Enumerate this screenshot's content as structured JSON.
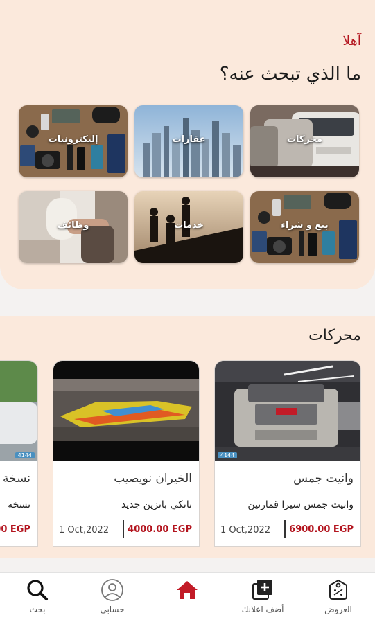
{
  "header": {
    "greeting": "آهلا",
    "question": "ما الذي تبحث عنه؟"
  },
  "categories": [
    {
      "label": "محركات",
      "icon": "cars-photo"
    },
    {
      "label": "عقارات",
      "icon": "skyscrapers-photo"
    },
    {
      "label": "إليكترونيات",
      "icon": "electronics-photo"
    },
    {
      "label": "بيع و شراء",
      "icon": "gadgets-photo"
    },
    {
      "label": "خدمات",
      "icon": "workers-photo"
    },
    {
      "label": "وظائف",
      "icon": "handshake-photo"
    }
  ],
  "section": {
    "title": "محركات"
  },
  "listings": [
    {
      "name": "وانيت جمس",
      "description": "وانيت جمس سيرا قمارتين",
      "price": "6900.00 EGP",
      "date": "1 Oct,2022",
      "badge": "4144"
    },
    {
      "name": "الخيران نويصيب",
      "description": "تانكي بانزين جديد",
      "price": "4000.00 EGP",
      "date": "1 Oct,2022",
      "badge": ""
    },
    {
      "name": "نسخة",
      "description": "نسخة",
      "price": "00 EGP",
      "date": "",
      "badge": "4144"
    }
  ],
  "nav": [
    {
      "label": "العروض",
      "icon": "offers-tag-icon"
    },
    {
      "label": "أضف اعلانك",
      "icon": "add-ad-icon"
    },
    {
      "label": "",
      "icon": "home-icon"
    },
    {
      "label": "حسابي",
      "icon": "account-icon"
    },
    {
      "label": "بحث",
      "icon": "search-icon"
    }
  ],
  "colors": {
    "accent": "#b3141e",
    "hero_bg": "#fbe9dc",
    "page_bg": "#f4f2f1"
  }
}
